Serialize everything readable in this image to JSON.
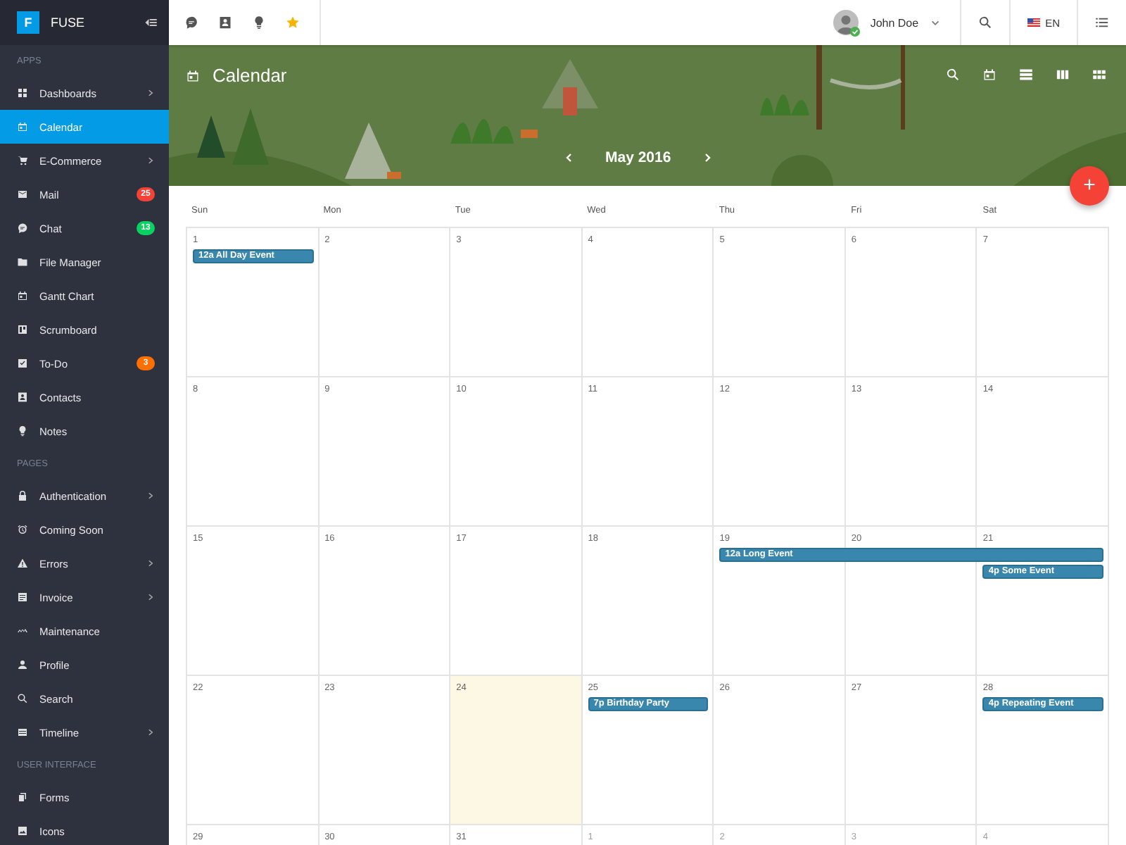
{
  "brand": {
    "letter": "F",
    "name": "FUSE"
  },
  "sidebar": {
    "sections": [
      {
        "title": "APPS",
        "items": [
          {
            "label": "Dashboards",
            "selected": false,
            "expandable": true
          },
          {
            "label": "Calendar",
            "selected": true,
            "expandable": false
          },
          {
            "label": "E-Commerce",
            "selected": false,
            "expandable": true
          },
          {
            "label": "Mail",
            "selected": false,
            "expandable": false,
            "badge": "25",
            "color": "#f44336"
          },
          {
            "label": "Chat",
            "selected": false,
            "expandable": false,
            "badge": "13",
            "color": "#09d261"
          },
          {
            "label": "File Manager",
            "selected": false,
            "expandable": false
          },
          {
            "label": "Gantt Chart",
            "selected": false,
            "expandable": false
          },
          {
            "label": "Scrumboard",
            "selected": false,
            "expandable": false
          },
          {
            "label": "To-Do",
            "selected": false,
            "expandable": false,
            "badge": "3",
            "color": "#ff6f00"
          },
          {
            "label": "Contacts",
            "selected": false,
            "expandable": false
          },
          {
            "label": "Notes",
            "selected": false,
            "expandable": false
          }
        ]
      },
      {
        "title": "PAGES",
        "items": [
          {
            "label": "Authentication",
            "selected": false,
            "expandable": true
          },
          {
            "label": "Coming Soon",
            "selected": false,
            "expandable": false
          },
          {
            "label": "Errors",
            "selected": false,
            "expandable": true
          },
          {
            "label": "Invoice",
            "selected": false,
            "expandable": true
          },
          {
            "label": "Maintenance",
            "selected": false,
            "expandable": false
          },
          {
            "label": "Profile",
            "selected": false,
            "expandable": false
          },
          {
            "label": "Search",
            "selected": false,
            "expandable": false
          },
          {
            "label": "Timeline",
            "selected": false,
            "expandable": true
          }
        ]
      },
      {
        "title": "USER INTERFACE",
        "items": [
          {
            "label": "Forms",
            "selected": false,
            "expandable": false
          },
          {
            "label": "Icons",
            "selected": false,
            "expandable": false
          }
        ]
      }
    ]
  },
  "toolbar": {
    "user": {
      "name": "John Doe",
      "online": true
    },
    "language": "EN"
  },
  "banner": {
    "title": "Calendar",
    "month": "May 2016",
    "fab": "+"
  },
  "calendar": {
    "weekdays": [
      "Sun",
      "Mon",
      "Tue",
      "Wed",
      "Thu",
      "Fri",
      "Sat"
    ],
    "weeks": [
      {
        "days": [
          {
            "label": "1",
            "other_month": false,
            "today": false,
            "continued": false,
            "events": [
              {
                "time": "12a",
                "title": "All Day Event"
              }
            ]
          },
          {
            "label": "2",
            "other_month": false,
            "today": false,
            "continued": false
          },
          {
            "label": "3",
            "other_month": false,
            "today": false,
            "continued": false
          },
          {
            "label": "4",
            "other_month": false,
            "today": false,
            "continued": false
          },
          {
            "label": "5",
            "other_month": false,
            "today": false,
            "continued": false
          },
          {
            "label": "6",
            "other_month": false,
            "today": false,
            "continued": false
          },
          {
            "label": "7",
            "other_month": false,
            "today": false,
            "continued": false
          }
        ]
      },
      {
        "days": [
          {
            "label": "8",
            "other_month": false,
            "today": false,
            "continued": false
          },
          {
            "label": "9",
            "other_month": false,
            "today": false,
            "continued": false
          },
          {
            "label": "10",
            "other_month": false,
            "today": false,
            "continued": false
          },
          {
            "label": "11",
            "other_month": false,
            "today": false,
            "continued": false
          },
          {
            "label": "12",
            "other_month": false,
            "today": false,
            "continued": false
          },
          {
            "label": "13",
            "other_month": false,
            "today": false,
            "continued": false
          },
          {
            "label": "14",
            "other_month": false,
            "today": false,
            "continued": false
          }
        ]
      },
      {
        "days": [
          {
            "label": "15",
            "other_month": false,
            "today": false,
            "continued": false
          },
          {
            "label": "16",
            "other_month": false,
            "today": false,
            "continued": false
          },
          {
            "label": "17",
            "other_month": false,
            "today": false,
            "continued": false
          },
          {
            "label": "18",
            "other_month": false,
            "today": false,
            "continued": false
          },
          {
            "label": "19",
            "other_month": false,
            "today": false,
            "continued": false,
            "events": [
              {
                "time": "12a",
                "title": "Long Event"
              }
            ]
          },
          {
            "label": "20",
            "other_month": false,
            "today": false,
            "continued": true
          },
          {
            "label": "21",
            "other_month": false,
            "today": false,
            "continued": true,
            "events": [
              {
                "time": "4p",
                "title": "Some Event"
              }
            ]
          }
        ]
      },
      {
        "days": [
          {
            "label": "22",
            "other_month": false,
            "today": false,
            "continued": false
          },
          {
            "label": "23",
            "other_month": false,
            "today": false,
            "continued": false
          },
          {
            "label": "24",
            "other_month": false,
            "today": true,
            "continued": false
          },
          {
            "label": "25",
            "other_month": false,
            "today": false,
            "continued": false,
            "events": [
              {
                "time": "7p",
                "title": "Birthday Party"
              }
            ]
          },
          {
            "label": "26",
            "other_month": false,
            "today": false,
            "continued": false
          },
          {
            "label": "27",
            "other_month": false,
            "today": false,
            "continued": false
          },
          {
            "label": "28",
            "other_month": false,
            "today": false,
            "continued": false,
            "events": [
              {
                "time": "4p",
                "title": "Repeating Event"
              }
            ]
          }
        ]
      },
      {
        "days": [
          {
            "label": "29",
            "other_month": false,
            "today": false,
            "continued": false
          },
          {
            "label": "30",
            "other_month": false,
            "today": false,
            "continued": false
          },
          {
            "label": "31",
            "other_month": false,
            "today": false,
            "continued": false
          },
          {
            "label": "1",
            "other_month": true,
            "today": false,
            "continued": false
          },
          {
            "label": "2",
            "other_month": true,
            "today": false,
            "continued": false
          },
          {
            "label": "3",
            "other_month": true,
            "today": false,
            "continued": false
          },
          {
            "label": "4",
            "other_month": true,
            "today": false,
            "continued": false
          }
        ]
      }
    ]
  }
}
